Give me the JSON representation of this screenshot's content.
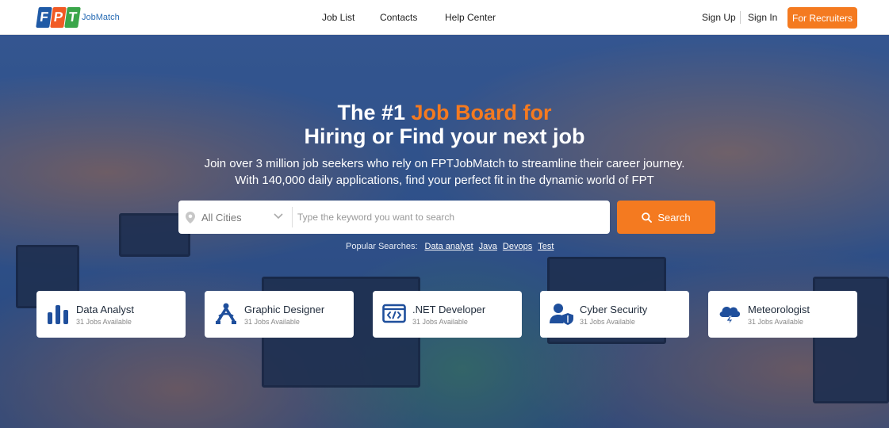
{
  "brand": {
    "logo_letters": [
      "F",
      "P",
      "T"
    ],
    "logo_sub": "JobMatch"
  },
  "nav": {
    "job_list": "Job List",
    "contacts": "Contacts",
    "help_center": "Help Center",
    "sign_up": "Sign Up",
    "sign_in": "Sign In",
    "recruiters": "For Recruiters"
  },
  "hero": {
    "title_part1": "The #1 ",
    "title_accent": "Job Board for",
    "title_line2": "Hiring or Find your next job",
    "subtitle_line1": "Join over 3 million job seekers who rely on FPTJobMatch to streamline their career journey.",
    "subtitle_line2": "With 140,000 daily applications, find your perfect fit in the dynamic world of FPT"
  },
  "search": {
    "city_label": "All Cities",
    "keyword_placeholder": "Type the keyword you want to search",
    "keyword_value": "",
    "button_label": "Search"
  },
  "popular": {
    "label": "Popular Searches:",
    "tags": [
      "Data analyst",
      "Java",
      "Devops",
      "Test"
    ]
  },
  "categories": [
    {
      "name": "Data Analyst",
      "count": "31 Jobs Available",
      "icon": "bar-chart-icon"
    },
    {
      "name": "Graphic Designer",
      "count": "31 Jobs Available",
      "icon": "pen-tool-icon"
    },
    {
      "name": ".NET Developer",
      "count": "31 Jobs Available",
      "icon": "code-window-icon"
    },
    {
      "name": "Cyber Security",
      "count": "31 Jobs Available",
      "icon": "user-shield-icon"
    },
    {
      "name": "Meteorologist",
      "count": "31 Jobs Available",
      "icon": "storm-cloud-icon"
    }
  ],
  "colors": {
    "accent": "#f47a20",
    "brand_blue": "#1f4f9c"
  }
}
